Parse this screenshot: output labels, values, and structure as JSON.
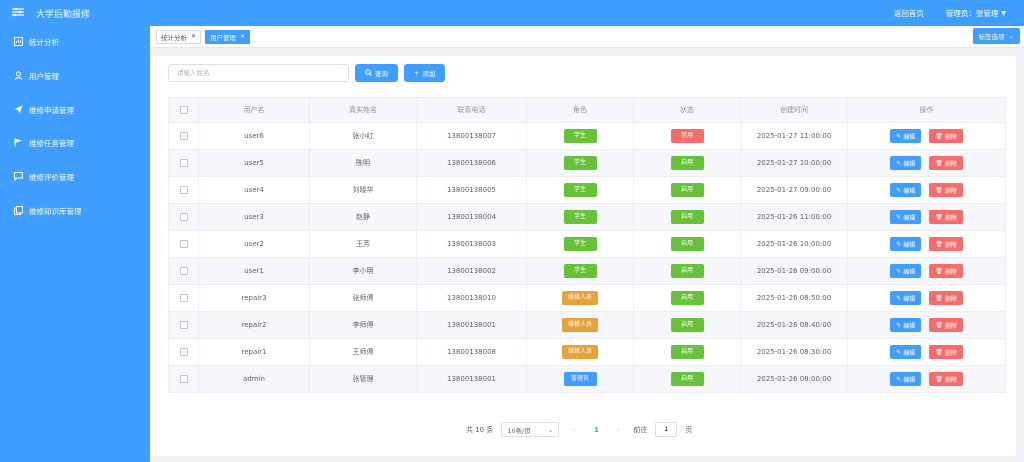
{
  "header": {
    "title": "大学后勤报修",
    "back_home": "返回首页",
    "admin_label": "管理员：张管理"
  },
  "sidebar": {
    "items": [
      {
        "label": "统计分析",
        "icon": "chart-icon"
      },
      {
        "label": "用户管理",
        "icon": "user-icon"
      },
      {
        "label": "维修申请管理",
        "icon": "send-icon"
      },
      {
        "label": "维修任务管理",
        "icon": "flag-icon"
      },
      {
        "label": "维修评价管理",
        "icon": "comment-icon"
      },
      {
        "label": "维修知识库管理",
        "icon": "copy-icon"
      }
    ]
  },
  "tabs": [
    {
      "label": "统计分析",
      "active": false
    },
    {
      "label": "用户管理",
      "active": true
    }
  ],
  "tab_options_label": "标签选项",
  "toolbar": {
    "search_placeholder": "请输入姓名",
    "search_label": "查询",
    "add_label": "添加"
  },
  "table": {
    "headers": [
      "用户名",
      "真实姓名",
      "联系电话",
      "角色",
      "状态",
      "创建时间",
      "操作"
    ],
    "rows": [
      {
        "username": "user6",
        "realname": "张小红",
        "phone": "13800138007",
        "role": "学生",
        "status": "禁用",
        "created": "2025-01-27 11:00:00"
      },
      {
        "username": "user5",
        "realname": "陈明",
        "phone": "13800138006",
        "role": "学生",
        "status": "启用",
        "created": "2025-01-27 10:00:00"
      },
      {
        "username": "user4",
        "realname": "刘晓华",
        "phone": "13800138005",
        "role": "学生",
        "status": "启用",
        "created": "2025-01-27 09:00:00"
      },
      {
        "username": "user3",
        "realname": "赵静",
        "phone": "13800138004",
        "role": "学生",
        "status": "启用",
        "created": "2025-01-26 11:00:00"
      },
      {
        "username": "user2",
        "realname": "王芳",
        "phone": "13800138003",
        "role": "学生",
        "status": "启用",
        "created": "2025-01-26 10:00:00"
      },
      {
        "username": "user1",
        "realname": "李小明",
        "phone": "13800138002",
        "role": "学生",
        "status": "启用",
        "created": "2025-01-26 09:00:00"
      },
      {
        "username": "repair3",
        "realname": "张师傅",
        "phone": "13800138010",
        "role": "维修人员",
        "status": "启用",
        "created": "2025-01-26 08:50:00"
      },
      {
        "username": "repair2",
        "realname": "李师傅",
        "phone": "13800138001",
        "role": "维修人员",
        "status": "启用",
        "created": "2025-01-26 08:40:00"
      },
      {
        "username": "repair1",
        "realname": "王师傅",
        "phone": "13800138008",
        "role": "维修人员",
        "status": "启用",
        "created": "2025-01-26 08:30:00"
      },
      {
        "username": "admin",
        "realname": "张管理",
        "phone": "13800138001",
        "role": "管理员",
        "status": "启用",
        "created": "2025-01-26 08:00:00"
      }
    ],
    "edit_label": "编辑",
    "delete_label": "删除"
  },
  "pagination": {
    "total": "共 10 条",
    "page_size": "10条/页",
    "current_page": "1",
    "goto_label": "前往",
    "goto_value": "1",
    "page_unit": "页"
  },
  "colors": {
    "primary": "#409eff",
    "student": "#67c23a",
    "repair": "#e6a23c",
    "admin": "#409eff",
    "enabled": "#67c23a",
    "disabled": "#f56c6c"
  }
}
